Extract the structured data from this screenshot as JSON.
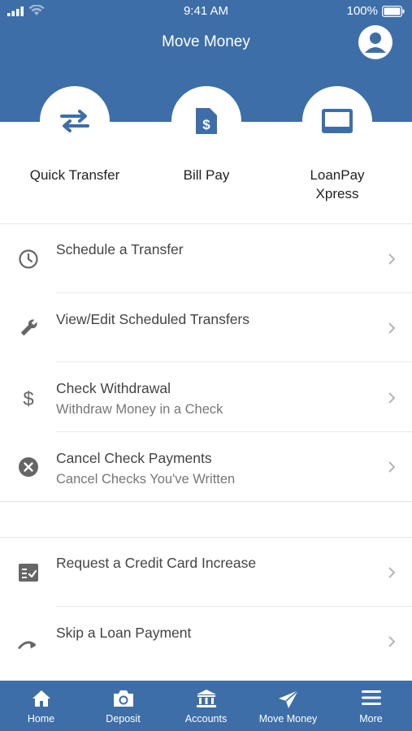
{
  "status_bar": {
    "time": "9:41 AM",
    "battery": "100%"
  },
  "header": {
    "title": "Move Money"
  },
  "quick_actions": [
    {
      "label": "Quick Transfer",
      "icon": "transfer-arrows-icon"
    },
    {
      "label": "Bill Pay",
      "icon": "bill-dollar-icon"
    },
    {
      "label": "LoanPay Xpress",
      "icon": "loan-card-icon"
    }
  ],
  "menu": [
    {
      "title": "Schedule a Transfer",
      "subtitle": "",
      "icon": "clock-icon"
    },
    {
      "title": "View/Edit Scheduled Transfers",
      "subtitle": "",
      "icon": "wrench-icon"
    },
    {
      "title": "Check Withdrawal",
      "subtitle": "Withdraw Money in a Check",
      "icon": "dollar-icon"
    },
    {
      "title": "Cancel Check Payments",
      "subtitle": "Cancel Checks You've Written",
      "icon": "cancel-circle-icon"
    },
    {
      "title": "Request a Credit Card Increase",
      "subtitle": "",
      "icon": "checklist-icon"
    },
    {
      "title": "Skip a Loan Payment",
      "subtitle": "",
      "icon": "skip-arrow-icon"
    }
  ],
  "tabs": [
    {
      "label": "Home",
      "icon": "home-icon"
    },
    {
      "label": "Deposit",
      "icon": "camera-icon"
    },
    {
      "label": "Accounts",
      "icon": "bank-icon"
    },
    {
      "label": "Move Money",
      "icon": "paper-plane-icon",
      "active": true
    },
    {
      "label": "More",
      "icon": "menu-icon"
    }
  ],
  "colors": {
    "brand_blue": "#3d6ea8",
    "icon_gray": "#666666"
  }
}
